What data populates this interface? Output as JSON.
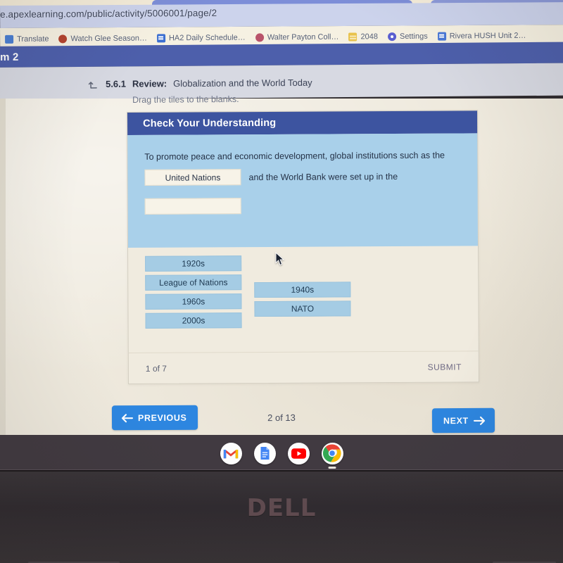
{
  "browser": {
    "url": "e.apexlearning.com/public/activity/5006001/page/2",
    "bookmarks": [
      {
        "label": "Translate",
        "icon": "translate-icon"
      },
      {
        "label": "Watch Glee Season…",
        "icon": "glee-icon"
      },
      {
        "label": "HA2 Daily Schedule…",
        "icon": "google-docs-icon"
      },
      {
        "label": "Walter Payton Coll…",
        "icon": "walter-payton-icon"
      },
      {
        "label": "2048",
        "icon": "game-2048-icon"
      },
      {
        "label": "Settings",
        "icon": "gear-icon"
      },
      {
        "label": "Rivera HUSH Unit 2…",
        "icon": "google-docs-icon"
      }
    ]
  },
  "course": {
    "banner_text": "m 2"
  },
  "lesson": {
    "up_arrow_icon": "arrow-up-left-icon",
    "number": "5.6.1",
    "review_label": "Review:",
    "title": "Globalization and the World Today",
    "drag_hint": "Drag the tiles to the blanks."
  },
  "card": {
    "header_title": "Check Your Understanding",
    "question_text": "To promote peace and economic development, global institutions such as the",
    "blank_1_value": "United Nations",
    "question_text_2": "and the World Bank were set up in the",
    "blank_2_value": "",
    "tiles_column_1": [
      "1920s",
      "League of Nations",
      "1960s",
      "2000s"
    ],
    "tiles_column_2": [
      "1940s",
      "NATO"
    ],
    "footer_count": "1 of 7",
    "submit_label": "SUBMIT"
  },
  "bottom_nav": {
    "previous_label": "PREVIOUS",
    "previous_icon": "arrow-left-icon",
    "next_label": "NEXT",
    "next_icon": "arrow-right-icon",
    "page_indicator": "2 of 13"
  },
  "dock": {
    "items": [
      {
        "name": "gmail-icon",
        "label": "Gmail"
      },
      {
        "name": "google-docs-icon",
        "label": "Docs"
      },
      {
        "name": "youtube-icon",
        "label": "YouTube"
      },
      {
        "name": "chrome-icon",
        "label": "Chrome"
      }
    ]
  },
  "laptop": {
    "brand": "DELL"
  },
  "colors": {
    "card_header_blue": "#3d54a0",
    "question_bg_blue": "#a9d0ea",
    "tile_blue": "#a5cce4",
    "nav_button_blue": "#2d86e0",
    "course_banner_blue": "#4d5fab",
    "page_cream": "#efeade"
  }
}
